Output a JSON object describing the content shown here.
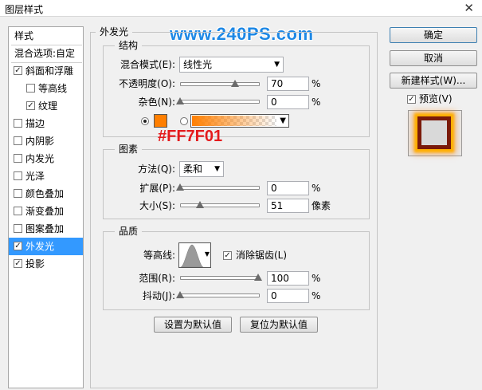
{
  "window": {
    "title": "图层样式",
    "close_glyph": "✕"
  },
  "watermark": "www.240PS.com",
  "annotation": "#FF7F01",
  "sidebar": {
    "header": "样式",
    "blend_options": "混合选项:自定",
    "items": [
      {
        "label": "斜面和浮雕",
        "checked": true,
        "indent": false
      },
      {
        "label": "等高线",
        "checked": false,
        "indent": true
      },
      {
        "label": "纹理",
        "checked": true,
        "indent": true
      },
      {
        "label": "描边",
        "checked": false,
        "indent": false
      },
      {
        "label": "内阴影",
        "checked": false,
        "indent": false
      },
      {
        "label": "内发光",
        "checked": false,
        "indent": false
      },
      {
        "label": "光泽",
        "checked": false,
        "indent": false
      },
      {
        "label": "颜色叠加",
        "checked": false,
        "indent": false
      },
      {
        "label": "渐变叠加",
        "checked": false,
        "indent": false
      },
      {
        "label": "图案叠加",
        "checked": false,
        "indent": false
      },
      {
        "label": "外发光",
        "checked": true,
        "indent": false,
        "active": true
      },
      {
        "label": "投影",
        "checked": true,
        "indent": false
      }
    ]
  },
  "panel": {
    "title": "外发光",
    "structure": {
      "legend": "结构",
      "blend_mode_label": "混合模式(E):",
      "blend_mode_value": "线性光",
      "opacity_label": "不透明度(O):",
      "opacity_value": "70",
      "opacity_level": 0.7,
      "noise_label": "杂色(N):",
      "noise_value": "0",
      "noise_level": 0,
      "percent": "%",
      "glow_color": "#FF7F01",
      "gradient_from": "#FF7F01"
    },
    "elements": {
      "legend": "图素",
      "technique_label": "方法(Q):",
      "technique_value": "柔和",
      "spread_label": "扩展(P):",
      "spread_value": "0",
      "spread_level": 0,
      "size_label": "大小(S):",
      "size_value": "51",
      "size_level": 0.25,
      "size_unit": "像素",
      "percent": "%"
    },
    "quality": {
      "legend": "品质",
      "contour_label": "等高线:",
      "antialias_label": "消除锯齿(L)",
      "antialias_checked": true,
      "range_label": "范围(R):",
      "range_value": "100",
      "range_level": 1.0,
      "jitter_label": "抖动(J):",
      "jitter_value": "0",
      "jitter_level": 0,
      "percent": "%"
    },
    "make_default": "设置为默认值",
    "reset_default": "复位为默认值"
  },
  "right_panel": {
    "ok": "确定",
    "cancel": "取消",
    "new_style": "新建样式(W)...",
    "preview_label": "预览(V)",
    "preview_checked": true
  }
}
